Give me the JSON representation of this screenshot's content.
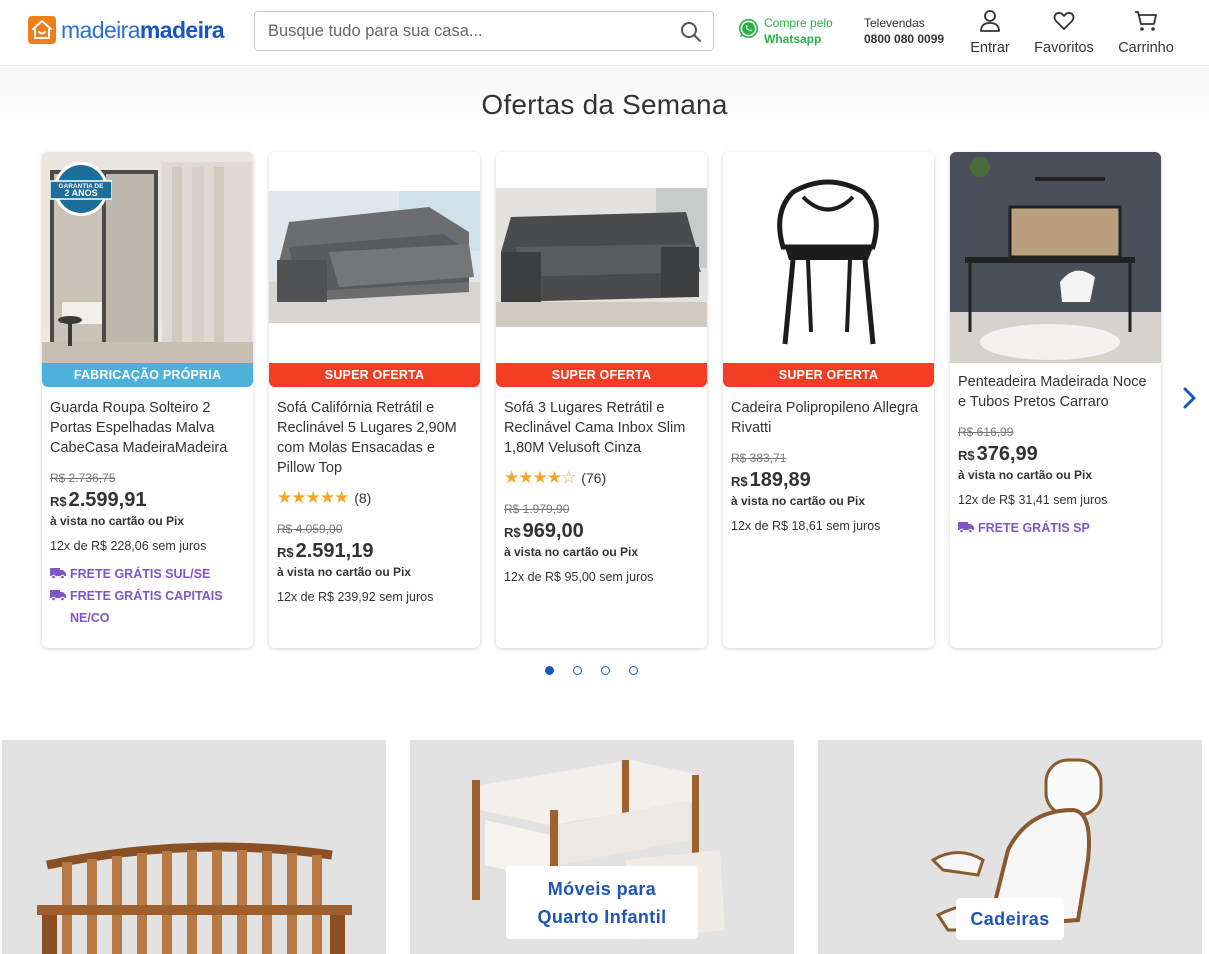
{
  "header": {
    "logo_part1": "madeira",
    "logo_part2": "madeira",
    "search_placeholder": "Busque tudo para sua casa...",
    "whatsapp_line1": "Compre pelo",
    "whatsapp_line2": "Whatsapp",
    "televendas_label": "Televendas",
    "televendas_phone": "0800 080 0099",
    "login_label": "Entrar",
    "favorites_label": "Favoritos",
    "cart_label": "Carrinho"
  },
  "section": {
    "title": "Ofertas da Semana",
    "badge_line1": "GARANTIA DE",
    "badge_line2": "2 ANOS"
  },
  "products": [
    {
      "tag": "FABRICAÇÃO PRÓPRIA",
      "title": "Guarda Roupa Solteiro 2 Portas Espelhadas Malva CabeCasa MadeiraMadeira",
      "old_price": "R$ 2.736,75",
      "currency": "R$",
      "price": "2.599,91",
      "pix": "à vista no cartão ou Pix",
      "installments": "12x de R$ 228,06 sem juros",
      "frete1": "FRETE GRÁTIS SUL/SE",
      "frete2": "FRETE GRÁTIS CAPITAIS NE/CO"
    },
    {
      "tag": "SUPER OFERTA",
      "title": "Sofá Califórnia Retrátil e Reclinável 5 Lugares 2,90M com Molas Ensacadas e Pillow Top",
      "stars": "★★★★★",
      "reviews": "(8)",
      "old_price": "R$ 4.059,00",
      "currency": "R$",
      "price": "2.591,19",
      "pix": "à vista no cartão ou Pix",
      "installments": "12x de R$ 239,92 sem juros"
    },
    {
      "tag": "SUPER OFERTA",
      "title": "Sofá 3 Lugares Retrátil e Reclinável Cama Inbox Slim 1,80M Velusoft Cinza",
      "stars": "★★★★☆",
      "reviews": "(76)",
      "old_price": "R$ 1.979,90",
      "currency": "R$",
      "price": "969,00",
      "pix": "à vista no cartão ou Pix",
      "installments": "12x de R$ 95,00 sem juros"
    },
    {
      "tag": "SUPER OFERTA",
      "title": "Cadeira Polipropileno Allegra Rivatti",
      "old_price": "R$ 383,71",
      "currency": "R$",
      "price": "189,89",
      "pix": "à vista no cartão ou Pix",
      "installments": "12x de R$ 18,61 sem juros"
    },
    {
      "title": "Penteadeira Madeirada Noce e Tubos Pretos Carraro",
      "old_price": "R$ 616,99",
      "currency": "R$",
      "price": "376,99",
      "pix": "à vista no cartão ou Pix",
      "installments": "12x de R$ 31,41 sem juros",
      "frete1": "FRETE GRÁTIS SP"
    }
  ],
  "carousel": {
    "pages": 4,
    "active_page": 1
  },
  "categories": [
    {
      "label": ""
    },
    {
      "label_line1": "Móveis para",
      "label_line2": "Quarto Infantil"
    },
    {
      "label": "Cadeiras"
    }
  ],
  "colors": {
    "brand_blue": "#1556c4",
    "brand_orange": "#f07f1b",
    "super_oferta_red": "#f43d25",
    "fabricacao_blue": "#4eb1db",
    "frete_purple": "#8156c7",
    "whatsapp_green": "#25b345",
    "star_gold": "#f5a623"
  }
}
